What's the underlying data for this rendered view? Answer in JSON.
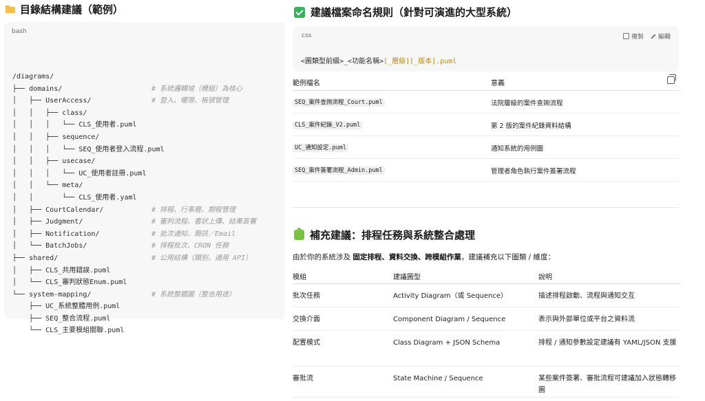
{
  "left": {
    "heading": "目錄結構建議（範例）",
    "code_lang": "bash",
    "tree": [
      {
        "text": "/diagrams/",
        "comment": ""
      },
      {
        "text": "├── domains/",
        "comment": "# 系統邏輯域（模組）為核心"
      },
      {
        "text": "│   ├── UserAccess/",
        "comment": "# 登入、權限、帳號管理"
      },
      {
        "text": "│   │   ├── class/",
        "comment": ""
      },
      {
        "text": "│   │   │   └── CLS_使用者.puml",
        "comment": ""
      },
      {
        "text": "│   │   ├── sequence/",
        "comment": ""
      },
      {
        "text": "│   │   │   └── SEQ_使用者登入流程.puml",
        "comment": ""
      },
      {
        "text": "│   │   ├── usecase/",
        "comment": ""
      },
      {
        "text": "│   │   │   └── UC_使用者註冊.puml",
        "comment": ""
      },
      {
        "text": "│   │   └── meta/",
        "comment": ""
      },
      {
        "text": "│   │       └── CLS_使用者.yaml",
        "comment": ""
      },
      {
        "text": "│   ├── CourtCalendar/",
        "comment": "# 排程、行事曆、期程管理"
      },
      {
        "text": "│   ├── Judgment/",
        "comment": "# 審判流程、書狀上傳、結果簽署"
      },
      {
        "text": "│   ├── Notification/",
        "comment": "# 批次通知、簡訊／Email"
      },
      {
        "text": "│   └── BatchJobs/",
        "comment": "# 排程批次、CRON 任務"
      },
      {
        "text": "├── shared/",
        "comment": "# 公用結構（類別、通用 API）"
      },
      {
        "text": "│   ├── CLS_共用錯誤.puml",
        "comment": ""
      },
      {
        "text": "│   └── CLS_審判狀態Enum.puml",
        "comment": ""
      },
      {
        "text": "└── system-mapping/",
        "comment": "# 系統整體圖（整合用途）"
      },
      {
        "text": "    ├── UC_系統整體用例.puml",
        "comment": ""
      },
      {
        "text": "    ├── SEQ_整合流程.puml",
        "comment": ""
      },
      {
        "text": "    └── CLS_主要模組關聯.puml",
        "comment": ""
      }
    ]
  },
  "right": {
    "heading": "建議檔案命名規則（針對可演進的大型系統）",
    "css_card": {
      "lang": "css",
      "copy_label": "複製",
      "edit_label": "編輯",
      "code_plain": "<圖類型前綴>_<功能名稱>",
      "code_highlight": "[_層級][_版本].puml"
    },
    "table1": {
      "headers": [
        "範例檔名",
        "意義"
      ],
      "rows": [
        {
          "file": "SEQ_案件查詢流程_Court.puml",
          "meaning": "法院層級的案件查詢流程"
        },
        {
          "file": "CLS_案件紀錄_V2.puml",
          "meaning": "第 2 版的案件紀錄資料結構"
        },
        {
          "file": "UC_通知設定.puml",
          "meaning": "通知系統的用例圖"
        },
        {
          "file": "SEQ_案件簽署流程_Admin.puml",
          "meaning": "管理者角色執行案件簽署流程"
        }
      ]
    },
    "heading2": "補充建議：排程任務與系統整合處理",
    "intro_pre": "由於你的系統涉及 ",
    "intro_bold": "固定排程、資料交換、跨模組作業",
    "intro_post": "，建議補充以下圖類 / 維度：",
    "table2": {
      "headers": [
        "模組",
        "建議圖型",
        "說明"
      ],
      "rows": [
        {
          "module": "批次任務",
          "diagram": "Activity Diagram（或 Sequence）",
          "note": "描述排程啟動、流程與通知交互"
        },
        {
          "module": "交換介面",
          "diagram": "Component Diagram / Sequence",
          "note": "表示與外部單位或平台之資料流"
        },
        {
          "module": "配置模式",
          "diagram": "Class Diagram + JSON Schema",
          "note": "排程 / 通知參數設定建議有 YAML/JSON 支援"
        },
        {
          "module": "審批流",
          "diagram": "State Machine / Sequence",
          "note": "某些案件簽署、審批流程可建議加入狀態轉移圖"
        }
      ]
    }
  }
}
